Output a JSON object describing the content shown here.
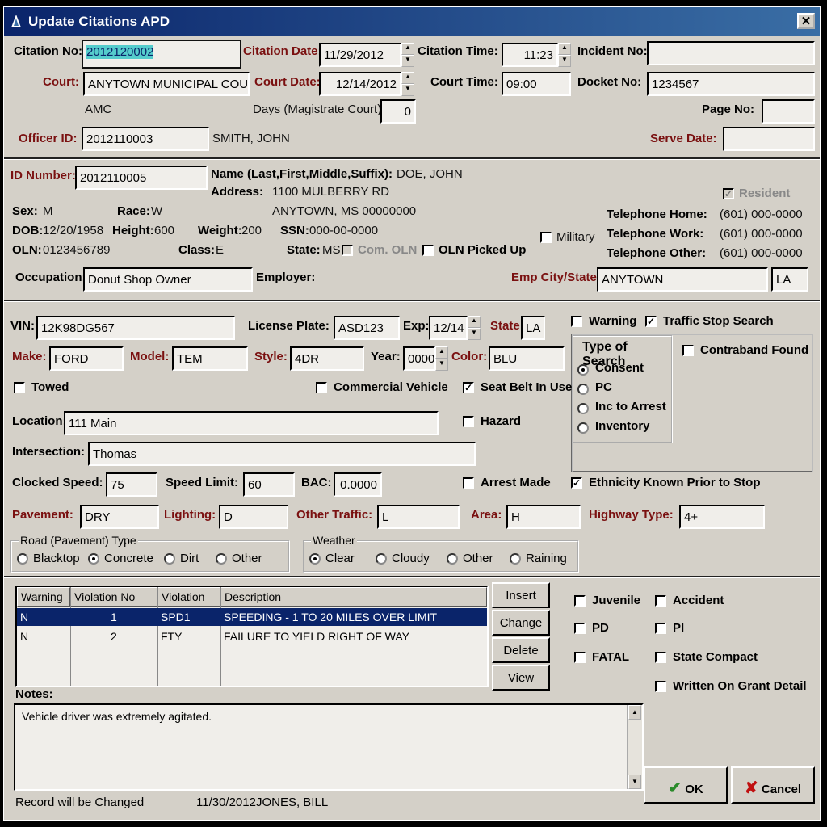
{
  "window": {
    "title": "Update Citations APD",
    "close_glyph": "✕"
  },
  "citation": {
    "citation_no_label": "Citation No:",
    "citation_no": "2012120002",
    "citation_date_label": "Citation Date:",
    "citation_date": "11/29/2012",
    "citation_time_label": "Citation Time:",
    "citation_time": "11:23",
    "incident_no_label": "Incident No:",
    "incident_no": "",
    "court_label": "Court:",
    "court": "ANYTOWN MUNICIPAL COURT",
    "court_date_label": "Court Date:",
    "court_date": "12/14/2012",
    "court_time_label": "Court Time:",
    "court_time": "09:00",
    "docket_no_label": "Docket No:",
    "docket_no": "1234567",
    "court_code": "AMC",
    "days_label": "Days (Magistrate Court):",
    "days": "0",
    "page_no_label": "Page No:",
    "page_no": "",
    "officer_id_label": "Officer ID:",
    "officer_id": "2012110003",
    "officer_name": "SMITH, JOHN",
    "serve_date_label": "Serve Date:",
    "serve_date": ""
  },
  "person": {
    "id_number_label": "ID Number:",
    "id_number": "2012110005",
    "name_label": "Name (Last,First,Middle,Suffix):",
    "name": "DOE, JOHN",
    "address_label": "Address:",
    "address1": "1100 MULBERRY RD",
    "address2": "ANYTOWN, MS 00000000",
    "resident_label": "Resident",
    "sex_label": "Sex:",
    "sex": "M",
    "race_label": "Race:",
    "race": "W",
    "dob_label": "DOB:",
    "dob": "12/20/1958",
    "height_label": "Height:",
    "height": "600",
    "weight_label": "Weight:",
    "weight": "200",
    "ssn_label": "SSN:",
    "ssn": "000-00-0000",
    "oln_label": "OLN:",
    "oln": "0123456789",
    "class_label": "Class:",
    "class": "E",
    "state_label": "State:",
    "state": "MS",
    "com_oln_label": "Com. OLN",
    "oln_picked_up_label": "OLN Picked Up",
    "military_label": "Military",
    "tel_home_label": "Telephone Home:",
    "tel_home": "(601) 000-0000",
    "tel_work_label": "Telephone Work:",
    "tel_work": "(601) 000-0000",
    "tel_other_label": "Telephone Other:",
    "tel_other": "(601) 000-0000",
    "occupation_label": "Occupation:",
    "occupation": "Donut Shop Owner",
    "employer_label": "Employer:",
    "emp_city_state_label": "Emp City/State:",
    "emp_city": "ANYTOWN",
    "emp_state": "LA"
  },
  "vehicle": {
    "vin_label": "VIN:",
    "vin": "12K98DG567",
    "plate_label": "License Plate:",
    "plate": "ASD123",
    "exp_label": "Exp:",
    "exp": "12/14",
    "state_label": "State:",
    "state": "LA",
    "warning_label": "Warning",
    "traffic_stop_search_label": "Traffic Stop Search",
    "make_label": "Make:",
    "make": "FORD",
    "model_label": "Model:",
    "model": "TEM",
    "style_label": "Style:",
    "style": "4DR",
    "year_label": "Year:",
    "year": "0000",
    "color_label": "Color:",
    "color": "BLU",
    "towed_label": "Towed",
    "commercial_label": "Commercial Vehicle",
    "seatbelt_label": "Seat Belt In Use",
    "search_group_title": "Type of Search",
    "search_options": [
      "Consent",
      "PC",
      "Inc to Arrest",
      "Inventory"
    ],
    "contraband_label": "Contraband Found",
    "location_label": "Location:",
    "location": "111 Main",
    "hazard_label": "Hazard",
    "intersection_label": "Intersection:",
    "intersection": "Thomas",
    "clocked_label": "Clocked Speed:",
    "clocked": "75",
    "limit_label": "Speed Limit:",
    "limit": "60",
    "bac_label": "BAC:",
    "bac": "0.0000",
    "arrest_label": "Arrest Made",
    "ethnicity_label": "Ethnicity Known Prior to Stop",
    "pavement_label": "Pavement:",
    "pavement": "DRY",
    "lighting_label": "Lighting:",
    "lighting": "D",
    "other_traffic_label": "Other Traffic:",
    "other_traffic": "L",
    "area_label": "Area:",
    "area": "H",
    "highway_label": "Highway Type:",
    "highway": "4+",
    "road_group_title": "Road (Pavement) Type",
    "road_options": [
      "Blacktop",
      "Concrete",
      "Dirt",
      "Other"
    ],
    "weather_group_title": "Weather",
    "weather_options": [
      "Clear",
      "Cloudy",
      "Other",
      "Raining"
    ]
  },
  "violations": {
    "columns": [
      "Warning",
      "Violation No",
      "Violation",
      "Description"
    ],
    "rows": [
      {
        "warning": "N",
        "no": "1",
        "code": "SPD1",
        "desc": "SPEEDING - 1 TO 20 MILES OVER LIMIT"
      },
      {
        "warning": "N",
        "no": "2",
        "code": "FTY",
        "desc": "FAILURE TO YIELD RIGHT OF WAY"
      }
    ],
    "buttons": [
      "Insert",
      "Change",
      "Delete",
      "View"
    ]
  },
  "flags": {
    "juvenile": "Juvenile",
    "accident": "Accident",
    "pd": "PD",
    "pi": "PI",
    "fatal": "FATAL",
    "state_compact": "State Compact",
    "grant": "Written On Grant Detail"
  },
  "notes": {
    "label": "Notes:",
    "text": "Vehicle driver was extremely agitated."
  },
  "footer": {
    "status": "Record will be Changed",
    "audit": "11/30/2012JONES, BILL",
    "ok_label": "OK",
    "cancel_label": "Cancel",
    "check_glyph": "✔",
    "x_glyph": "✘"
  },
  "colors": {
    "title_bar": "#0a246a",
    "label_red": "#7a1010",
    "selection": "#0a246a"
  }
}
